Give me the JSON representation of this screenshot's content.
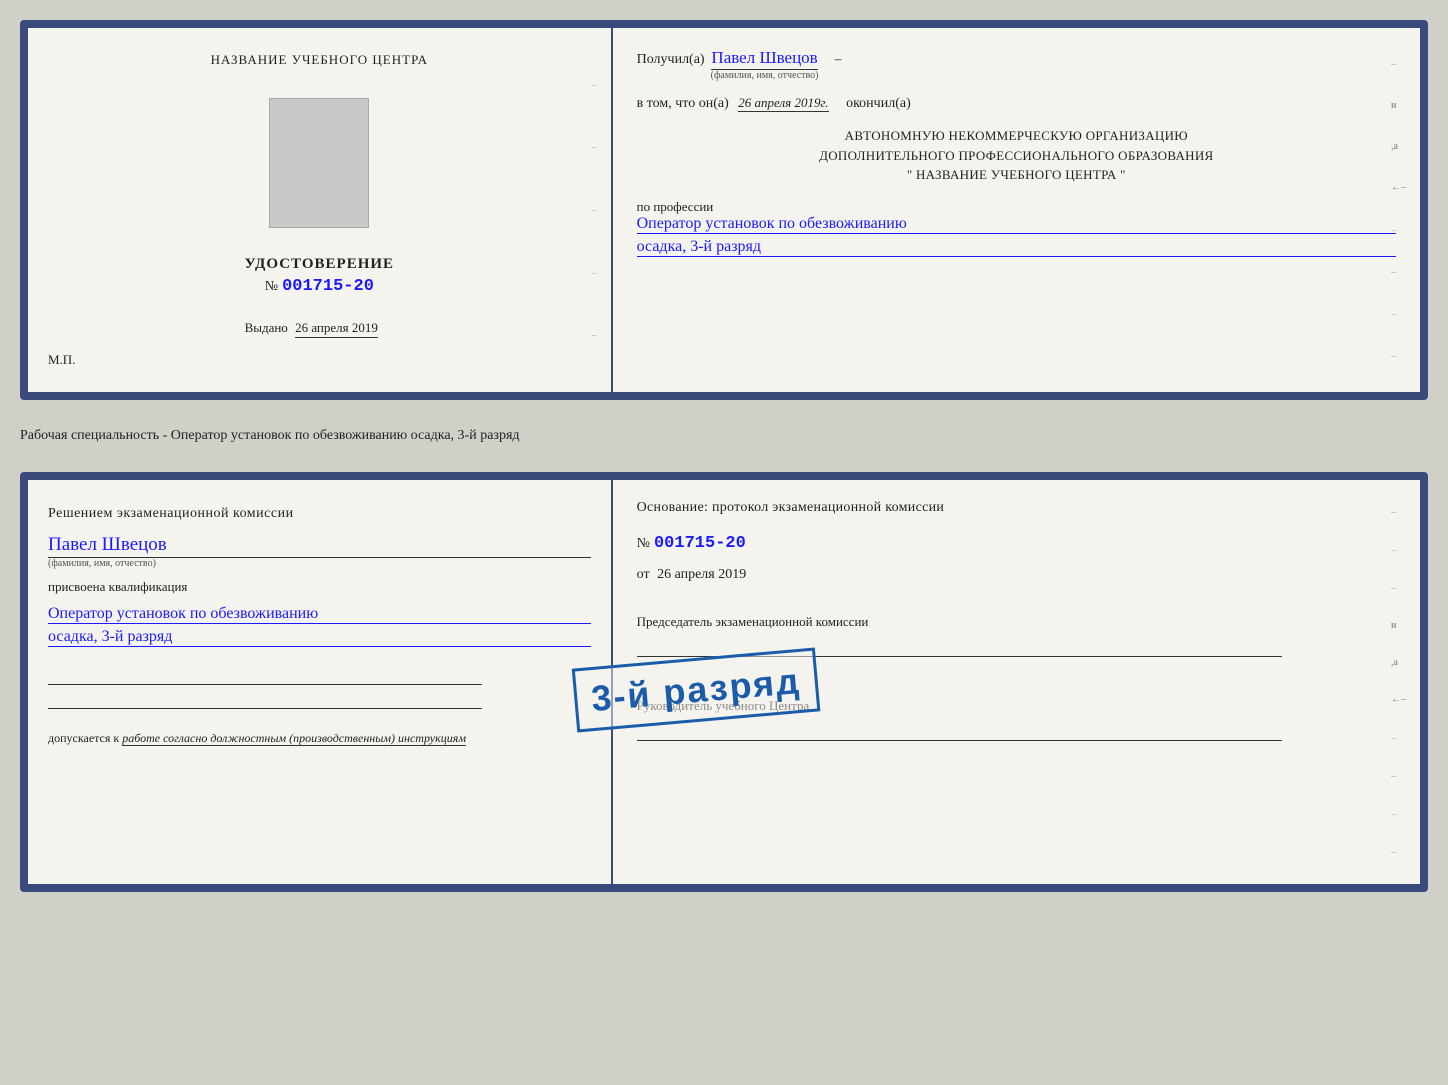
{
  "page": {
    "background": "#d0cfc8"
  },
  "cert1": {
    "left": {
      "org_name": "НАЗВАНИЕ УЧЕБНОГО ЦЕНТРА",
      "title": "УДОСТОВЕРЕНИЕ",
      "number_label": "№",
      "number": "001715-20",
      "issued_label": "Выдано",
      "issued_date": "26 апреля 2019",
      "mp_label": "М.П."
    },
    "right": {
      "received_prefix": "Получил(а)",
      "person_name": "Павел Швецов",
      "name_subtitle": "(фамилия, имя, отчество)",
      "date_prefix": "в том, что он(а)",
      "date_value": "26 апреля 2019г.",
      "date_suffix": "окончил(а)",
      "org_line1": "АВТОНОМНУЮ НЕКОММЕРЧЕСКУЮ ОРГАНИЗАЦИЮ",
      "org_line2": "ДОПОЛНИТЕЛЬНОГО ПРОФЕССИОНАЛЬНОГО ОБРАЗОВАНИЯ",
      "org_line3": "\"  НАЗВАНИЕ УЧЕБНОГО ЦЕНТРА  \"",
      "profession_label": "по профессии",
      "profession_name": "Оператор установок по обезвоживанию",
      "profession_rank": "осадка, 3-й разряд"
    }
  },
  "separator": {
    "text": "Рабочая специальность - Оператор установок по обезвоживанию осадка, 3-й разряд"
  },
  "cert2": {
    "left": {
      "decision_title": "Решением экзаменационной комиссии",
      "person_name": "Павел Швецов",
      "name_subtitle": "(фамилия, имя, отчество)",
      "assigned_label": "присвоена квалификация",
      "qual_name": "Оператор установок по обезвоживанию",
      "qual_rank": "осадка, 3-й разряд",
      "допускается_label": "допускается к",
      "допускается_value": "работе согласно должностным (производственным) инструкциям"
    },
    "right": {
      "basis_title": "Основание: протокол экзаменационной комиссии",
      "protocol_label": "№",
      "protocol_number": "001715-20",
      "date_prefix": "от",
      "date_value": "26 апреля 2019",
      "chairman_label": "Председатель экзаменационной комиссии",
      "director_label": "Руководитель учебного Центра"
    },
    "stamp": {
      "text": "3-й разряд"
    }
  }
}
